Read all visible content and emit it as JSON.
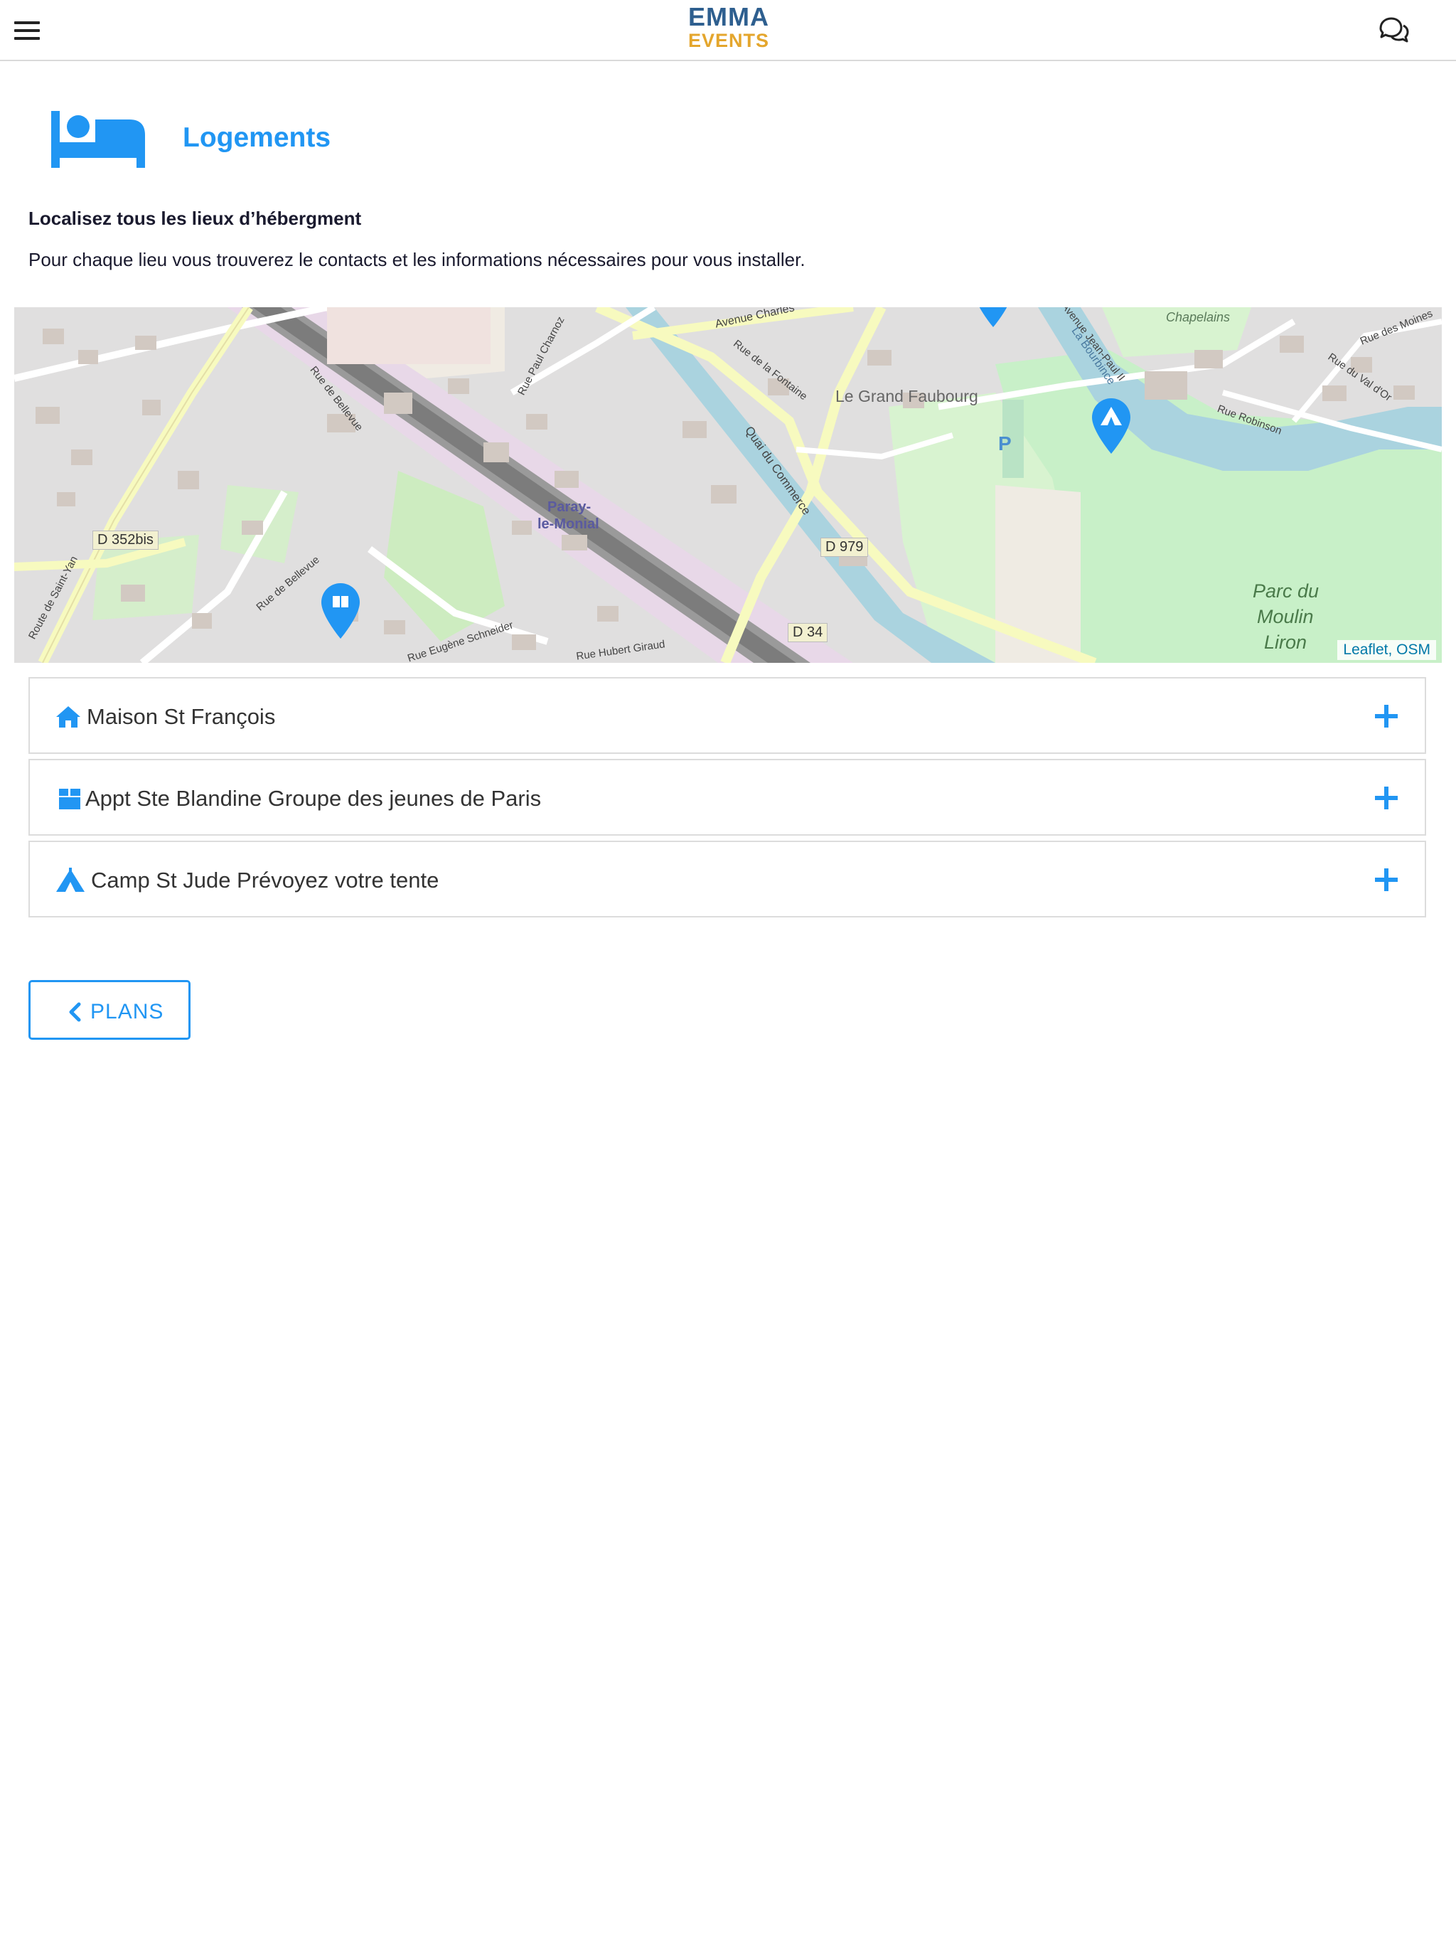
{
  "header": {
    "logo_line1": "EMMA",
    "logo_line2": "EVENTS",
    "menu_icon": "hamburger-menu-icon",
    "chat_icon": "chat-bubbles-icon"
  },
  "page": {
    "icon": "bed-icon",
    "title": "Logements",
    "subtitle": "Localisez tous les lieux d’hébergment",
    "description": "Pour chaque lieu vous trouverez le contacts et les informations nécessaires pour vous installer."
  },
  "map": {
    "labels": {
      "town": "Paray-",
      "town2": "le-Monial",
      "quarter": "Le Grand Faubourg",
      "park1": "Parc du",
      "park2": "Moulin",
      "park3": "Liron",
      "chapelains": "Chapelains",
      "road_d352": "D 352bis",
      "road_d979": "D 979",
      "road_d34": "D 34",
      "rue_bellevue": "Rue de Bellevue",
      "rue_bellevue2": "Rue de Bellevue",
      "route_st_yan": "Route de Saint-Yan",
      "rue_charnoz": "Rue Paul Charnoz",
      "quai_commerce": "Quai du Commerce",
      "rue_fontaine": "Rue de la Fontaine",
      "avenue_charles": "Avenue Charles",
      "rue_schneider": "Rue Eugène Schneider",
      "rue_giraud": "Rue Hubert Giraud",
      "rue_robinson": "Rue Robinson",
      "rue_val_or": "Rue du Val d'Or",
      "rue_moines": "Rue des Moines",
      "avenue_jean_paul": "Avenue Jean-Paul II",
      "bourbince": "La Bourbince",
      "parking": "P"
    },
    "attribution_leaflet": "Leaflet",
    "attribution_sep": ", ",
    "attribution_osm": "OSM",
    "marker_colors": {
      "marker": "#2196f3"
    }
  },
  "accommodations": [
    {
      "icon": "home-icon",
      "label": "Maison St François"
    },
    {
      "icon": "box-icon",
      "label": "Appt Ste Blandine Groupe des jeunes de Paris"
    },
    {
      "icon": "campground-icon",
      "label": "Camp St Jude Prévoyez votre tente"
    }
  ],
  "back_button": {
    "label": "PLANS",
    "icon": "chevron-left-icon"
  },
  "colors": {
    "accent": "#2196f3",
    "logo_blue": "#2e5f8f",
    "logo_gold": "#e4a62d"
  }
}
